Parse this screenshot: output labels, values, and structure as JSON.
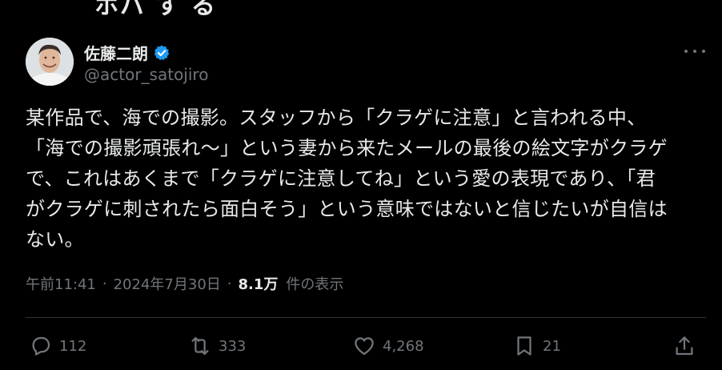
{
  "top_cutoff_text": "ホバ す る",
  "author": {
    "display_name": "佐藤二朗",
    "handle": "@actor_satojiro",
    "verified": true
  },
  "tweet": {
    "lines": [
      "某作品で、海での撮影。スタッフから「クラゲに注意」と言われる中、",
      "「海での撮影頑張れ〜」という妻から来たメールの最後の絵文字がクラゲ",
      "で、これはあくまで「クラゲに注意してね」という愛の表現であり、「君",
      "がクラゲに刺されたら面白そう」という意味ではないと信じたいが自信は",
      "ない。"
    ]
  },
  "meta": {
    "time": "午前11:41",
    "separator": "·",
    "date": "2024年7月30日",
    "views_count": "8.1万",
    "views_label": "件の表示"
  },
  "actions": {
    "reply_count": "112",
    "retweet_count": "333",
    "like_count": "4,268",
    "bookmark_count": "21"
  },
  "icons": {
    "verified": "verified-badge-icon",
    "more": "more-icon",
    "reply": "reply-icon",
    "retweet": "retweet-icon",
    "like": "heart-icon",
    "bookmark": "bookmark-icon",
    "share": "share-icon"
  },
  "colors": {
    "background": "#000000",
    "text": "#e7e9ea",
    "secondary": "#71767b",
    "verified": "#1d9bf0",
    "divider": "#2f3336"
  }
}
